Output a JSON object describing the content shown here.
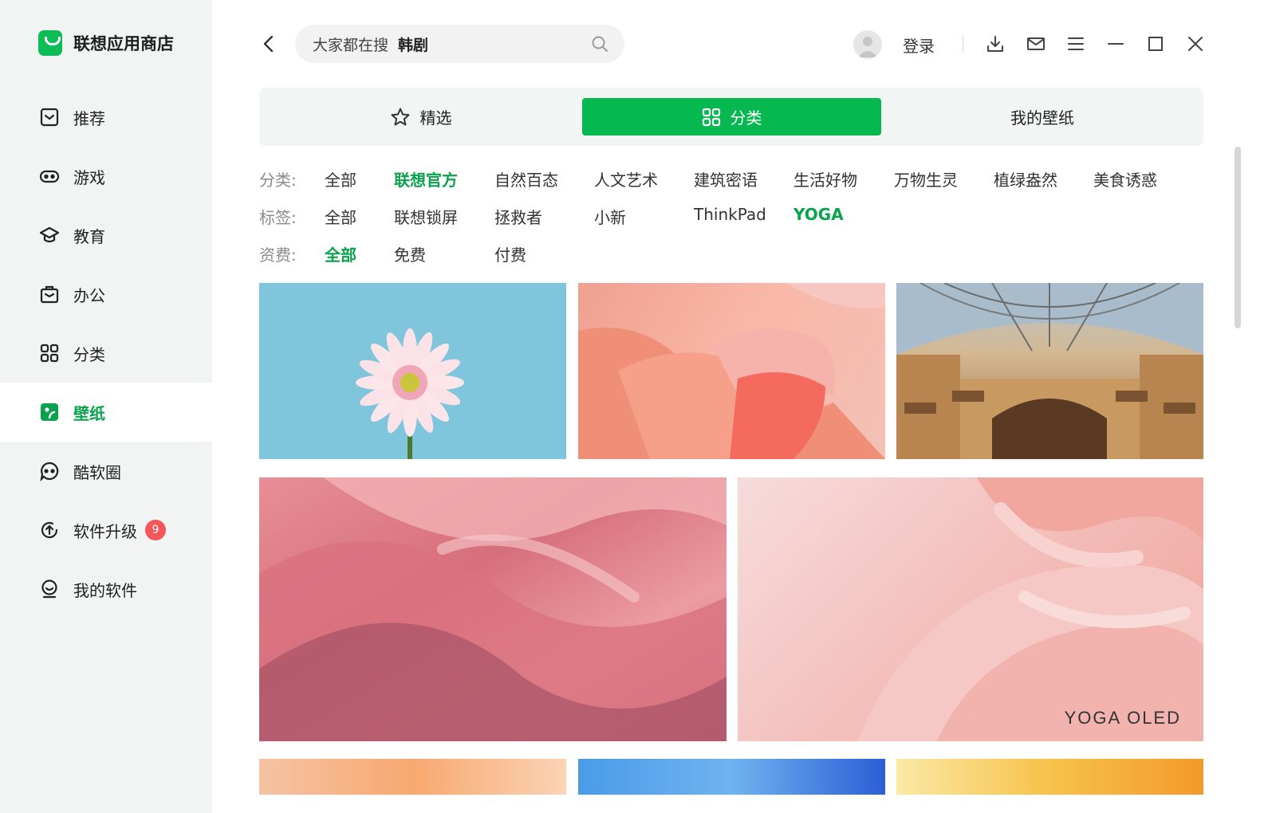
{
  "app": {
    "name": "联想应用商店"
  },
  "sidebar": {
    "items": [
      {
        "label": "推荐",
        "icon": "recommend-icon"
      },
      {
        "label": "游戏",
        "icon": "gamepad-icon"
      },
      {
        "label": "教育",
        "icon": "graduation-cap-icon"
      },
      {
        "label": "办公",
        "icon": "briefcase-icon"
      },
      {
        "label": "分类",
        "icon": "grid-icon"
      },
      {
        "label": "壁纸",
        "icon": "wallpaper-icon",
        "active": true
      },
      {
        "label": "酷软圈",
        "icon": "chat-bubble-icon"
      },
      {
        "label": "软件升级",
        "icon": "upgrade-icon",
        "badge": "9"
      },
      {
        "label": "我的软件",
        "icon": "my-software-icon"
      }
    ]
  },
  "header": {
    "search": {
      "placeholder": "大家都在搜",
      "hot": "韩剧"
    },
    "login": "登录"
  },
  "tabs": [
    {
      "label": "精选",
      "icon": "star-icon"
    },
    {
      "label": "分类",
      "icon": "grid-icon",
      "active": true
    },
    {
      "label": "我的壁纸"
    }
  ],
  "filters": {
    "category": {
      "label": "分类:",
      "options": [
        "全部",
        "联想官方",
        "自然百态",
        "人文艺术",
        "建筑密语",
        "生活好物",
        "万物生灵",
        "植绿盎然",
        "美食诱惑"
      ],
      "selected": "联想官方"
    },
    "tag": {
      "label": "标签:",
      "options": [
        "全部",
        "联想锁屏",
        "拯救者",
        "小新",
        "ThinkPad",
        "YOGA"
      ],
      "selected": "YOGA"
    },
    "price": {
      "label": "资费:",
      "options": [
        "全部",
        "免费",
        "付费"
      ],
      "selected": "全部"
    }
  },
  "wallpapers": [
    {
      "name": "gerbera-flower-wallpaper"
    },
    {
      "name": "coral-ribbon-wallpaper"
    },
    {
      "name": "galleria-dome-wallpaper"
    },
    {
      "name": "pink-silk-wallpaper"
    },
    {
      "name": "pink-waves-wallpaper",
      "watermark": "YOGA OLED"
    },
    {
      "name": "peach-layers-wallpaper"
    },
    {
      "name": "blue-abstract-wallpaper"
    },
    {
      "name": "yellow-orange-wallpaper"
    }
  ],
  "colors": {
    "accent": "#06b850",
    "accent_text": "#0aa24d",
    "badge": "#f5565a"
  }
}
